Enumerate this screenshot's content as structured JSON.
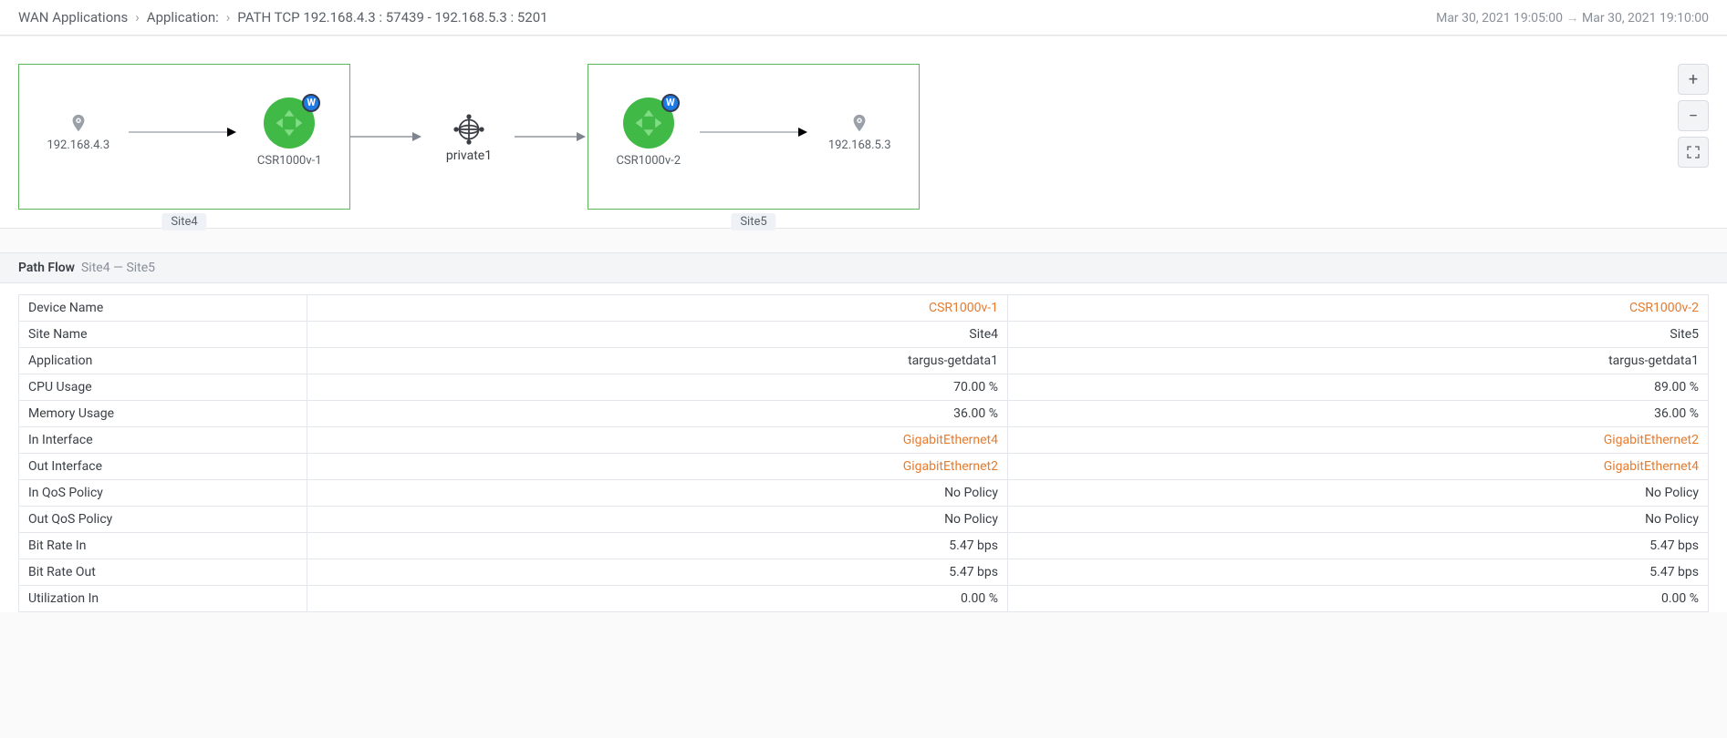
{
  "breadcrumb": {
    "root": "WAN Applications",
    "app_label": "Application:",
    "path_title": "PATH TCP 192.168.4.3 : 57439 - 192.168.5.3 : 5201"
  },
  "time_range": {
    "from": "Mar 30, 2021 19:05:00",
    "to": "Mar 30, 2021 19:10:00"
  },
  "topology": {
    "sites": [
      {
        "site_label": "Site4",
        "host_ip": "192.168.4.3",
        "router_name": "CSR1000v-1",
        "router_badge": "W"
      },
      {
        "site_label": "Site5",
        "host_ip": "192.168.5.3",
        "router_name": "CSR1000v-2",
        "router_badge": "W"
      }
    ],
    "transport": "private1"
  },
  "controls": {
    "zoom_in": "+",
    "zoom_out": "−",
    "fit": "⤢"
  },
  "path_flow": {
    "title": "Path Flow",
    "subtitle": "Site4 — Site5",
    "rows": [
      {
        "label": "Device Name",
        "v1": "CSR1000v-1",
        "v2": "CSR1000v-2",
        "link": true
      },
      {
        "label": "Site Name",
        "v1": "Site4",
        "v2": "Site5",
        "link": false
      },
      {
        "label": "Application",
        "v1": "targus-getdata1",
        "v2": "targus-getdata1",
        "link": false
      },
      {
        "label": "CPU Usage",
        "v1": "70.00 %",
        "v2": "89.00 %",
        "link": false
      },
      {
        "label": "Memory Usage",
        "v1": "36.00 %",
        "v2": "36.00 %",
        "link": false
      },
      {
        "label": "In Interface",
        "v1": "GigabitEthernet4",
        "v2": "GigabitEthernet2",
        "link": true
      },
      {
        "label": "Out Interface",
        "v1": "GigabitEthernet2",
        "v2": "GigabitEthernet4",
        "link": true
      },
      {
        "label": "In QoS Policy",
        "v1": "No Policy",
        "v2": "No Policy",
        "link": false
      },
      {
        "label": "Out QoS Policy",
        "v1": "No Policy",
        "v2": "No Policy",
        "link": false
      },
      {
        "label": "Bit Rate In",
        "v1": "5.47 bps",
        "v2": "5.47 bps",
        "link": false
      },
      {
        "label": "Bit Rate Out",
        "v1": "5.47 bps",
        "v2": "5.47 bps",
        "link": false
      },
      {
        "label": "Utilization In",
        "v1": "0.00 %",
        "v2": "0.00 %",
        "link": false
      }
    ]
  }
}
